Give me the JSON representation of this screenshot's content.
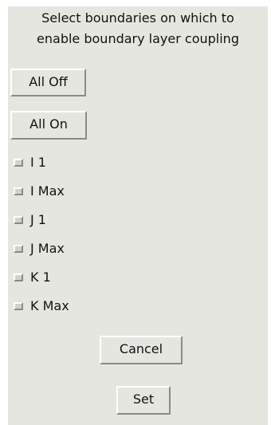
{
  "dialog": {
    "instructions_line1": "Select boundaries on which to",
    "instructions_line2": "enable boundary layer coupling",
    "all_off_label": "All Off",
    "all_on_label": "All On",
    "options": [
      {
        "label": "I 1",
        "checked": false
      },
      {
        "label": "I Max",
        "checked": false
      },
      {
        "label": "J 1",
        "checked": false
      },
      {
        "label": "J Max",
        "checked": false
      },
      {
        "label": "K 1",
        "checked": false
      },
      {
        "label": "K Max",
        "checked": false
      }
    ],
    "cancel_label": "Cancel",
    "set_label": "Set"
  },
  "colors": {
    "panel_background": "#e6e6e1",
    "page_background": "#ffffff",
    "text": "#111111",
    "checkbox_fill": "#d2d2cd"
  }
}
